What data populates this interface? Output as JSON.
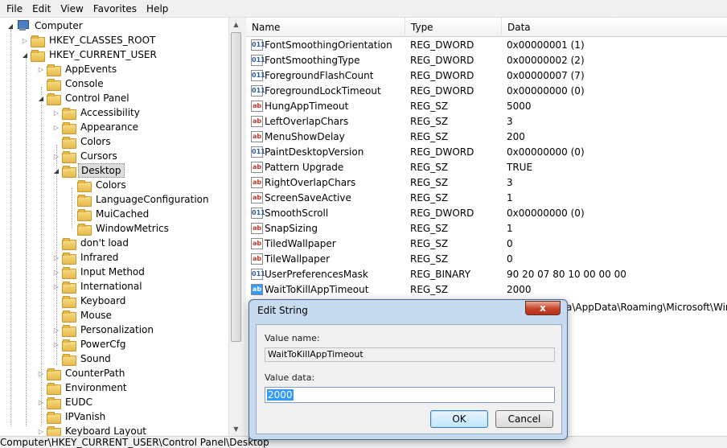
{
  "menu": [
    "File",
    "Edit",
    "View",
    "Favorites",
    "Help"
  ],
  "tree": {
    "root": "Computer",
    "items": [
      {
        "label": "HKEY_CLASSES_ROOT",
        "level": 1,
        "expander": "collapsed"
      },
      {
        "label": "HKEY_CURRENT_USER",
        "level": 1,
        "expander": "expanded"
      },
      {
        "label": "AppEvents",
        "level": 2,
        "expander": "collapsed"
      },
      {
        "label": "Console",
        "level": 2,
        "expander": "none"
      },
      {
        "label": "Control Panel",
        "level": 2,
        "expander": "expanded"
      },
      {
        "label": "Accessibility",
        "level": 3,
        "expander": "collapsed"
      },
      {
        "label": "Appearance",
        "level": 3,
        "expander": "collapsed"
      },
      {
        "label": "Colors",
        "level": 3,
        "expander": "none"
      },
      {
        "label": "Cursors",
        "level": 3,
        "expander": "collapsed"
      },
      {
        "label": "Desktop",
        "level": 3,
        "expander": "expanded",
        "selected": true
      },
      {
        "label": "Colors",
        "level": 4,
        "expander": "none"
      },
      {
        "label": "LanguageConfiguration",
        "level": 4,
        "expander": "none"
      },
      {
        "label": "MuiCached",
        "level": 4,
        "expander": "none"
      },
      {
        "label": "WindowMetrics",
        "level": 4,
        "expander": "none"
      },
      {
        "label": "don't load",
        "level": 3,
        "expander": "none"
      },
      {
        "label": "Infrared",
        "level": 3,
        "expander": "collapsed"
      },
      {
        "label": "Input Method",
        "level": 3,
        "expander": "collapsed"
      },
      {
        "label": "International",
        "level": 3,
        "expander": "collapsed"
      },
      {
        "label": "Keyboard",
        "level": 3,
        "expander": "none"
      },
      {
        "label": "Mouse",
        "level": 3,
        "expander": "none"
      },
      {
        "label": "Personalization",
        "level": 3,
        "expander": "collapsed"
      },
      {
        "label": "PowerCfg",
        "level": 3,
        "expander": "collapsed"
      },
      {
        "label": "Sound",
        "level": 3,
        "expander": "none"
      },
      {
        "label": "CounterPath",
        "level": 2,
        "expander": "collapsed"
      },
      {
        "label": "Environment",
        "level": 2,
        "expander": "none"
      },
      {
        "label": "EUDC",
        "level": 2,
        "expander": "collapsed"
      },
      {
        "label": "IPVanish",
        "level": 2,
        "expander": "none"
      },
      {
        "label": "Keyboard Layout",
        "level": 2,
        "expander": "collapsed"
      }
    ]
  },
  "list": {
    "columns": [
      "Name",
      "Type",
      "Data"
    ],
    "rows": [
      {
        "name": "FontSmoothingOrientation",
        "type": "REG_DWORD",
        "data": "0x00000001 (1)",
        "icon": "dword-value-icon"
      },
      {
        "name": "FontSmoothingType",
        "type": "REG_DWORD",
        "data": "0x00000002 (2)",
        "icon": "dword-value-icon"
      },
      {
        "name": "ForegroundFlashCount",
        "type": "REG_DWORD",
        "data": "0x00000007 (7)",
        "icon": "dword-value-icon"
      },
      {
        "name": "ForegroundLockTimeout",
        "type": "REG_DWORD",
        "data": "0x00000000 (0)",
        "icon": "dword-value-icon"
      },
      {
        "name": "HungAppTimeout",
        "type": "REG_SZ",
        "data": "5000",
        "icon": "string-value-icon"
      },
      {
        "name": "LeftOverlapChars",
        "type": "REG_SZ",
        "data": "3",
        "icon": "string-value-icon"
      },
      {
        "name": "MenuShowDelay",
        "type": "REG_SZ",
        "data": "200",
        "icon": "string-value-icon"
      },
      {
        "name": "PaintDesktopVersion",
        "type": "REG_DWORD",
        "data": "0x00000000 (0)",
        "icon": "dword-value-icon"
      },
      {
        "name": "Pattern Upgrade",
        "type": "REG_SZ",
        "data": "TRUE",
        "icon": "string-value-icon"
      },
      {
        "name": "RightOverlapChars",
        "type": "REG_SZ",
        "data": "3",
        "icon": "string-value-icon"
      },
      {
        "name": "ScreenSaveActive",
        "type": "REG_SZ",
        "data": "1",
        "icon": "string-value-icon"
      },
      {
        "name": "SmoothScroll",
        "type": "REG_DWORD",
        "data": "0x00000000 (0)",
        "icon": "dword-value-icon"
      },
      {
        "name": "SnapSizing",
        "type": "REG_SZ",
        "data": "1",
        "icon": "string-value-icon"
      },
      {
        "name": "TiledWallpaper",
        "type": "REG_SZ",
        "data": "0",
        "icon": "string-value-icon"
      },
      {
        "name": "TileWallpaper",
        "type": "REG_SZ",
        "data": "0",
        "icon": "string-value-icon"
      },
      {
        "name": "UserPreferencesMask",
        "type": "REG_BINARY",
        "data": "90 20 07 80 10 00 00 00",
        "icon": "binary-value-icon"
      },
      {
        "name": "WaitToKillAppTimeout",
        "type": "REG_SZ",
        "data": "2000",
        "icon": "string-value-icon",
        "selected": true
      }
    ],
    "partial_row": {
      "data_tail": "a\\AppData\\Roaming\\Microsoft\\Win..."
    }
  },
  "status_bar": "Computer\\HKEY_CURRENT_USER\\Control Panel\\Desktop",
  "dialog": {
    "title": "Edit String",
    "close_label": "x",
    "value_name_label": "Value name:",
    "value_name": "WaitToKillAppTimeout",
    "value_data_label": "Value data:",
    "value_data": "2000",
    "ok_label": "OK",
    "cancel_label": "Cancel"
  }
}
